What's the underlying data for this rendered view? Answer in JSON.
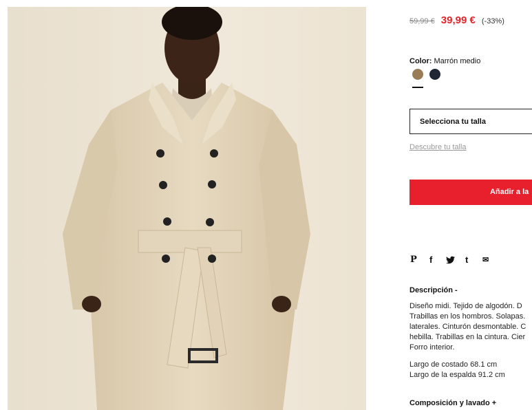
{
  "product": {
    "image_alt": "Trench coat model photo"
  },
  "price": {
    "old": "59,99 €",
    "new": "39,99 €",
    "discount": "(-33%)"
  },
  "color": {
    "label": "Color:",
    "value": "Marrón medio",
    "swatches": [
      {
        "name": "Marrón medio",
        "hex": "#9a7d57",
        "selected": true
      },
      {
        "name": "Navy",
        "hex": "#1e2535",
        "selected": false
      }
    ]
  },
  "size": {
    "select_label": "Selecciona tu talla",
    "guide_link": "Descubre tu talla"
  },
  "cart": {
    "add_label": "Añadir a la"
  },
  "share": {
    "icons": [
      "pinterest-icon",
      "facebook-icon",
      "twitter-icon",
      "tumblr-icon",
      "email-icon"
    ],
    "glyphs": [
      "P",
      "f",
      "🐦",
      "t",
      "✉"
    ]
  },
  "description": {
    "title": "Descripción -",
    "lines": [
      "Diseño midi. Tejido de algodón. D",
      "Trabillas en los hombros. Solapas.",
      "laterales. Cinturón desmontable. C",
      "hebilla. Trabillas en la cintura. Cier",
      "Forro interior."
    ],
    "measure_1": "Largo de costado 68.1 cm",
    "measure_2": "Largo de la espalda 91.2 cm"
  },
  "composition": {
    "title": "Composición y lavado +"
  },
  "colors": {
    "accent": "#e8202e",
    "price_red": "#e3242b",
    "coat": "#e2d3b9",
    "background": "#ece4d4"
  }
}
